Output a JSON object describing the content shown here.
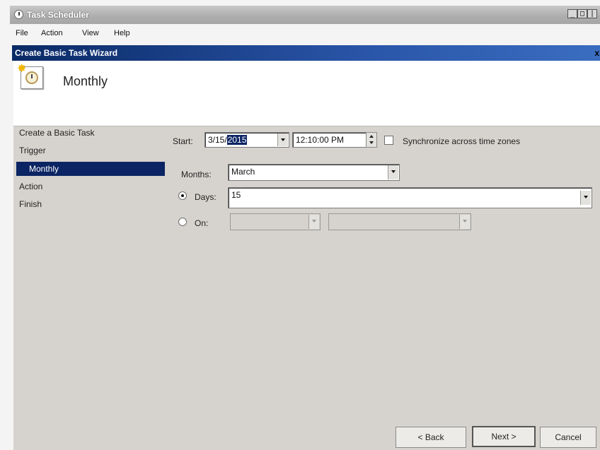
{
  "app": {
    "title": "Task Scheduler",
    "controls": {
      "minimize": "_",
      "restore": "□",
      "close": "|"
    }
  },
  "menu": [
    "File",
    "Action",
    "View",
    "Help"
  ],
  "wizard": {
    "title": "Create Basic Task Wizard",
    "close": "x",
    "banner_title": "Monthly"
  },
  "nav": {
    "items": [
      "Create a Basic Task",
      "Trigger",
      "Monthly",
      "Action",
      "Finish"
    ],
    "selected": "Monthly"
  },
  "form": {
    "start_label": "Start:",
    "start_date_prefix": "3/15/",
    "start_date_selected": "2015",
    "start_time": "12:10:00 PM",
    "sync_label": "Synchronize across time zones",
    "sync_checked": false,
    "months_label": "Months:",
    "months_value": "March",
    "days_label": "Days:",
    "days_value": "15",
    "days_checked": true,
    "on_label": "On:",
    "on_checked": false
  },
  "buttons": {
    "back": "< Back",
    "next": "Next >",
    "cancel": "Cancel"
  },
  "colors": {
    "wizard_titlebar": "#0a2a66",
    "selection": "#0b2463",
    "pane": "#d6d3ce"
  }
}
